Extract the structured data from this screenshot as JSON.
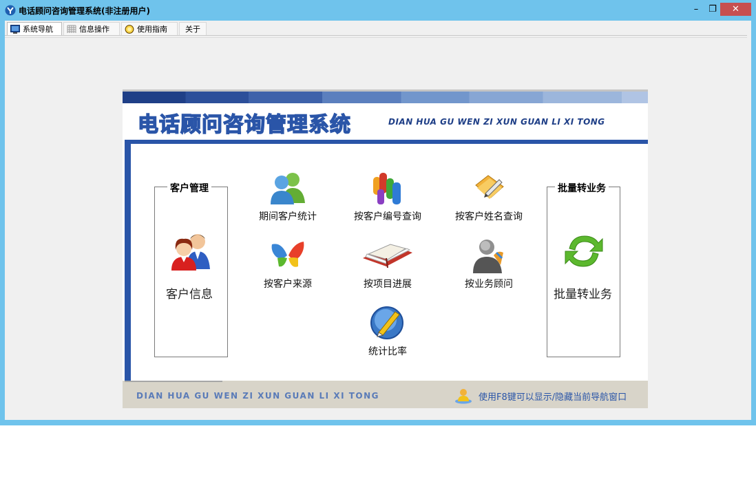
{
  "window": {
    "title": "电话顾问咨询管理系统(非注册用户)"
  },
  "window_controls": {
    "minimize": "–",
    "restore": "❐",
    "close": "✕"
  },
  "tabs": [
    {
      "label": "系统导航",
      "icon": "monitor-icon"
    },
    {
      "label": "信息操作",
      "icon": "grid-icon"
    },
    {
      "label": "使用指南",
      "icon": "guide-icon"
    },
    {
      "label": "关于",
      "icon": ""
    }
  ],
  "banner": {
    "title_cn": "电话顾问咨询管理系统",
    "title_en": "DIAN HUA GU WEN ZI XUN GUAN LI XI TONG"
  },
  "left_group": {
    "title": "客户管理",
    "button_label": "客户信息"
  },
  "right_group": {
    "title": "批量转业务",
    "button_label": "批量转业务"
  },
  "items": [
    {
      "label": "期间客户统计",
      "icon": "users-icon"
    },
    {
      "label": "按客户编号查询",
      "icon": "people-group-icon"
    },
    {
      "label": "按客户姓名查询",
      "icon": "folder-pencil-icon"
    },
    {
      "label": "按客户来源",
      "icon": "butterfly-icon"
    },
    {
      "label": "按项目进展",
      "icon": "open-book-icon"
    },
    {
      "label": "按业务顾问",
      "icon": "consultant-icon"
    },
    {
      "label": "统计比率",
      "icon": "pencil-circle-icon"
    }
  ],
  "footer": {
    "text_en": "DIAN HUA GU WEN ZI XUN GUAN LI XI TONG",
    "hint": "使用F8键可以显示/隐藏当前导航窗口"
  }
}
